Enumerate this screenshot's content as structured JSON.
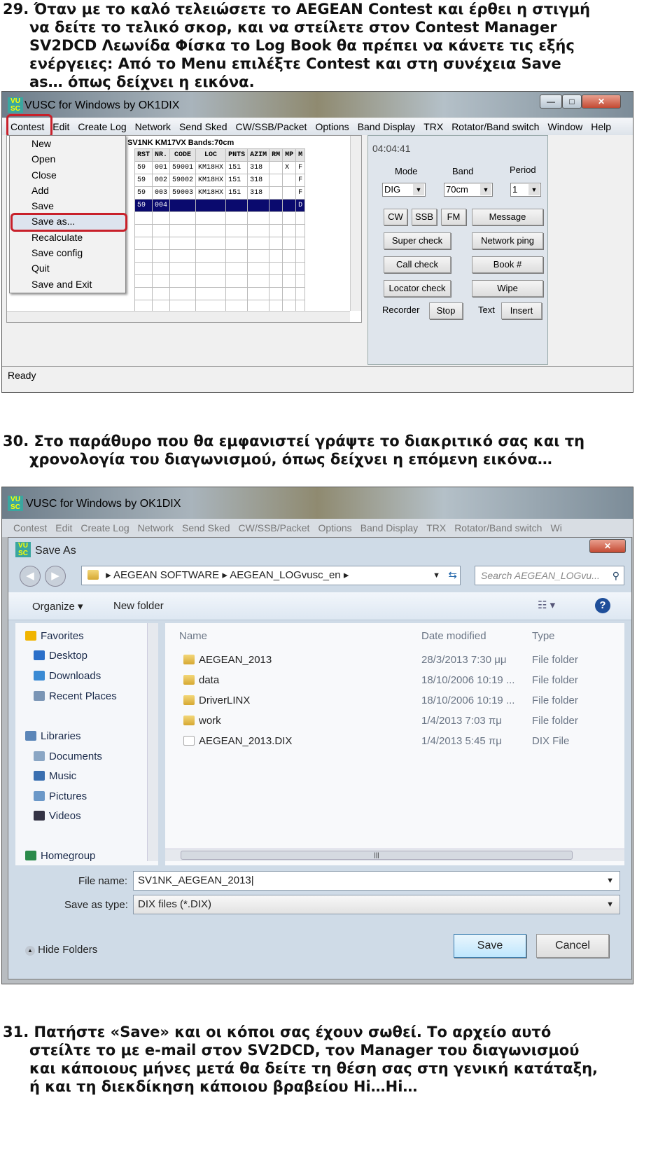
{
  "step29": {
    "number": "29.",
    "lines": [
      "Όταν με το καλό τελειώσετε το AEGEAN Contest και έρθει η στιγμή",
      "να δείτε το τελικό σκορ, και να στείλετε στον Contest Manager",
      "SV2DCD Λεωνίδα Φίσκα το Log Book θα πρέπει να κάνετε τις εξής",
      "ενέργειες: Από το Menu επιλέξτε Contest και στη συνέχεια Save",
      "as… όπως δείχνει η εικόνα."
    ]
  },
  "screen1": {
    "title": "VUSC for Windows by OK1DIX",
    "logo": "VU SC",
    "menu": [
      "Contest",
      "Edit",
      "Create Log",
      "Network",
      "Send Sked",
      "CW/SSB/Packet",
      "Options",
      "Band Display",
      "TRX",
      "Rotator/Band switch",
      "Window",
      "Help"
    ],
    "contest_menu": [
      "New",
      "Open",
      "Close",
      "Add",
      "Save",
      "Save as...",
      "Recalculate",
      "Save config",
      "Quit",
      "Save and Exit"
    ],
    "log_header": "SV1NK  KM17VX  Bands:70cm",
    "columns": [
      "RST",
      "NR.",
      "CODE",
      "LOC",
      "PNTS",
      "AZIM",
      "RM",
      "MP",
      "M"
    ],
    "rows": [
      [
        "59",
        "001",
        "59001",
        "KM18HX",
        "151",
        "318",
        "",
        "X",
        "F"
      ],
      [
        "59",
        "002",
        "59002",
        "KM18HX",
        "151",
        "318",
        "",
        "",
        "F"
      ],
      [
        "59",
        "003",
        "59003",
        "KM18HX",
        "151",
        "318",
        "",
        "",
        "F"
      ],
      [
        "59",
        "004",
        "",
        "",
        "",
        "",
        "",
        "",
        "D"
      ]
    ],
    "panel": {
      "time": "04:04:41",
      "mode_label": "Mode",
      "band_label": "Band",
      "period_label": "Period",
      "mode": "DIG",
      "band": "70cm",
      "period": "1",
      "buttons": {
        "cw": "CW",
        "ssb": "SSB",
        "fm": "FM",
        "message": "Message",
        "super_check": "Super check",
        "network_ping": "Network ping",
        "call_check": "Call check",
        "book": "Book #",
        "locator_check": "Locator check",
        "wipe": "Wipe",
        "stop": "Stop",
        "insert": "Insert"
      },
      "recorder_label": "Recorder",
      "text_label": "Text"
    },
    "status": "Ready"
  },
  "step30": {
    "number": "30.",
    "lines": [
      "Στο παράθυρο που θα εμφανιστεί γράψτε το διακριτικό σας και τη",
      "χρονολογία του διαγωνισμού, όπως δείχνει η επόμενη εικόνα…"
    ]
  },
  "screen2": {
    "title": "VUSC for Windows by OK1DIX",
    "menu": [
      "Contest",
      "Edit",
      "Create Log",
      "Network",
      "Send Sked",
      "CW/SSB/Packet",
      "Options",
      "Band Display",
      "TRX",
      "Rotator/Band switch",
      "Wi"
    ],
    "dialog": {
      "title": "Save As",
      "path": [
        "AEGEAN SOFTWARE",
        "AEGEAN_LOGvusc_en"
      ],
      "search_placeholder": "Search AEGEAN_LOGvu...",
      "organize": "Organize ▾",
      "new_folder": "New folder",
      "nav": [
        {
          "label": "Favorites",
          "icon": "star-icon",
          "group": true
        },
        {
          "label": "Desktop",
          "icon": "desktop-icon"
        },
        {
          "label": "Downloads",
          "icon": "downloads-icon"
        },
        {
          "label": "Recent Places",
          "icon": "recent-places-icon"
        },
        {
          "label": "Libraries",
          "icon": "libraries-icon",
          "group": true
        },
        {
          "label": "Documents",
          "icon": "documents-icon"
        },
        {
          "label": "Music",
          "icon": "music-icon"
        },
        {
          "label": "Pictures",
          "icon": "pictures-icon"
        },
        {
          "label": "Videos",
          "icon": "videos-icon"
        },
        {
          "label": "Homegroup",
          "icon": "homegroup-icon",
          "group": true
        }
      ],
      "columns": [
        "Name",
        "Date modified",
        "Type"
      ],
      "files": [
        {
          "name": "AEGEAN_2013",
          "date": "28/3/2013 7:30 μμ",
          "type": "File folder",
          "kind": "folder"
        },
        {
          "name": "data",
          "date": "18/10/2006 10:19 ...",
          "type": "File folder",
          "kind": "folder"
        },
        {
          "name": "DriverLINX",
          "date": "18/10/2006 10:19 ...",
          "type": "File folder",
          "kind": "folder"
        },
        {
          "name": "work",
          "date": "1/4/2013 7:03 πμ",
          "type": "File folder",
          "kind": "folder"
        },
        {
          "name": "AEGEAN_2013.DIX",
          "date": "1/4/2013 5:45 πμ",
          "type": "DIX File",
          "kind": "file"
        }
      ],
      "file_name_label": "File name:",
      "file_name": "SV1NK_AEGEAN_2013",
      "save_type_label": "Save as type:",
      "save_type": "DIX files (*.DIX)",
      "hide_folders": "Hide Folders",
      "save": "Save",
      "cancel": "Cancel"
    }
  },
  "step31": {
    "number": "31.",
    "lines": [
      "Πατήστε «Save» και οι κόποι σας έχουν σωθεί. Το αρχείο αυτό",
      "στείλτε το με e-mail στον SV2DCD, τον Manager του διαγωνισμού",
      "και κάποιους μήνες μετά θα δείτε τη θέση σας στη γενική κατάταξη,",
      "ή και τη διεκδίκηση κάποιου βραβείου Hi…Hi…"
    ]
  },
  "colors": {
    "highlight_red": "#c8202a",
    "selected_row": "#0a0a6e"
  }
}
